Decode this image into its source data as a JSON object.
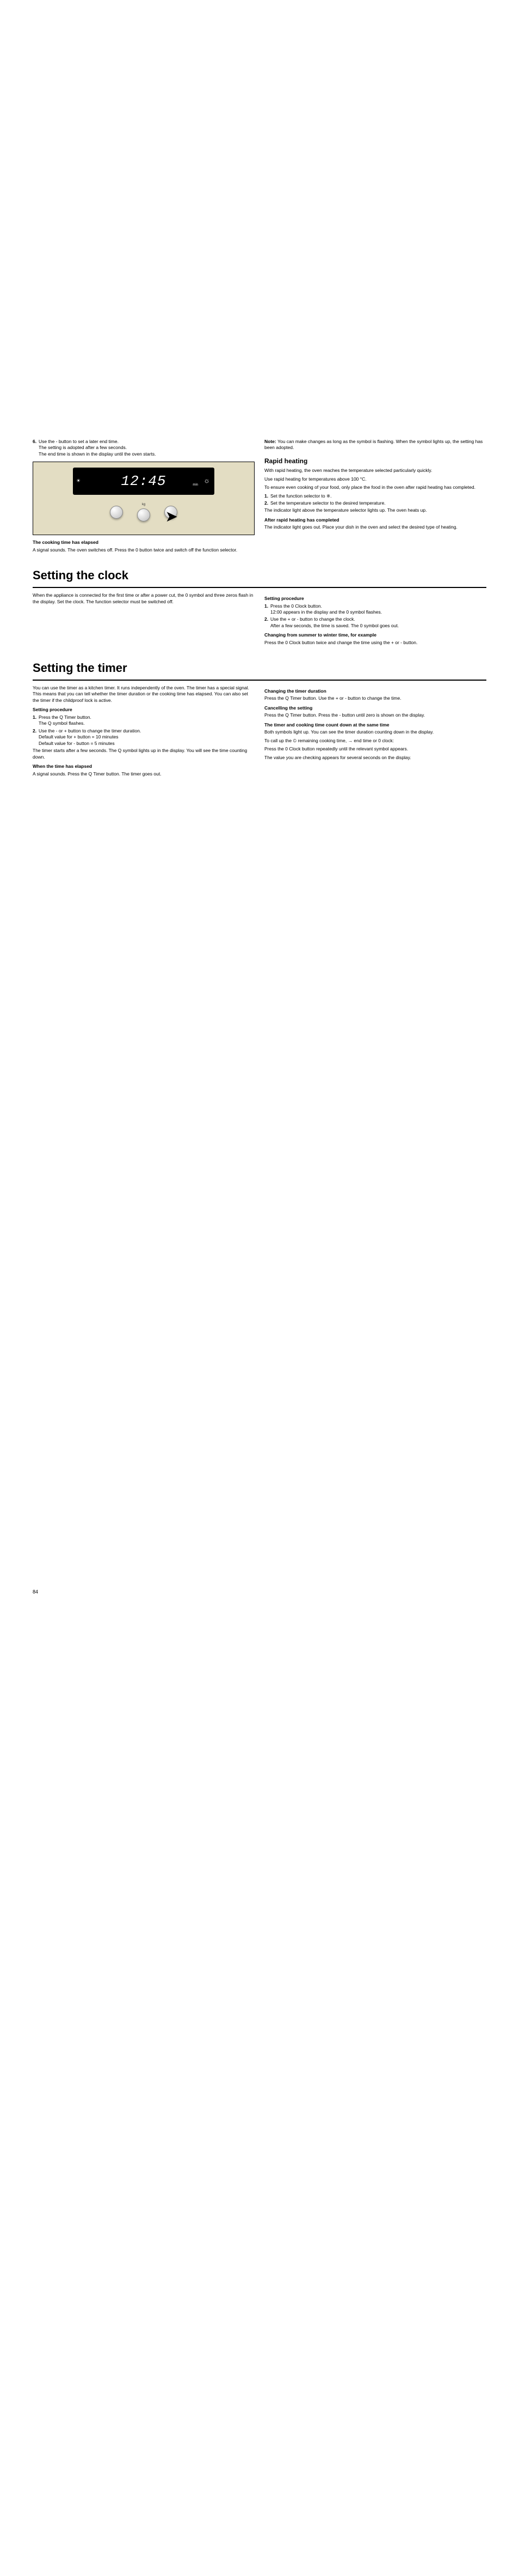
{
  "step6": {
    "n": "6.",
    "t": "Use the - button to set a later end time.",
    "l2": "The setting is adopted after a few seconds.",
    "l3": "The end time is shown in the display until the oven starts."
  },
  "display": {
    "time": "12:45",
    "min": "min"
  },
  "elapsed": {
    "h": "The cooking time has elapsed",
    "p1": "A signal sounds. The oven switches off. Press the 0 button twice and switch off the function selector."
  },
  "note": {
    "b": "Note: ",
    "t": "You can make changes as long as the symbol is flashing. When the symbol lights up, the setting has been adopted."
  },
  "rapid": {
    "h": "Rapid heating",
    "p1": "With rapid heating, the oven reaches the temperature selected particularly quickly.",
    "p2": "Use rapid heating for temperatures above 100 °C.",
    "p3": "To ensure even cooking of your food, only place the food in the oven after rapid heating has completed.",
    "s1n": "1.",
    "s1": "Set the function selector to ※.",
    "s2n": "2.",
    "s2": "Set the temperature selector to the desired temperature.",
    "p4": "The indicator light above the temperature selector lights up. The oven heats up.",
    "h2": "After rapid heating has completed",
    "p5": "The indicator light goes out. Place your dish in the oven and select the desired type of heating."
  },
  "clock": {
    "h": "Setting the clock",
    "intro": "When the appliance is connected for the first time or after a power cut, the 0 symbol and three zeros flash in the display. Set the clock. The function selector must be switched off.",
    "proc": "Setting procedure",
    "s1n": "1.",
    "s1a": "Press the 0 Clock button.",
    "s1b": "12:00 appears in the display and the 0  symbol flashes.",
    "s2n": "2.",
    "s2a": "Use the + or - button to change the clock.",
    "s2b": "After a few seconds, the time is saved. The 0 symbol goes out.",
    "chg": "Changing from summer to winter time, for example",
    "chgp": "Press the 0 Clock button twice and change the time using the + or - button."
  },
  "timer": {
    "h": "Setting the timer",
    "intro": "You can use the timer as a kitchen timer. It runs independently of the oven. The timer has a special signal. This means that you can tell whether the timer duration or the cooking time has elapsed. You can also set the timer if the childproof lock is active.",
    "proc": "Setting procedure",
    "s1n": "1.",
    "s1a": "Press the Q Timer button.",
    "s1b": "The Q symbol flashes.",
    "s2n": "2.",
    "s2a": "Use the - or + button to change the timer duration.",
    "s2b": "Default value for + button = 10 minutes",
    "s2c": "Default value for - button = 5 minutes",
    "p3": "The timer starts after a few seconds. The Q symbol lights up in the display. You will see the time counting down.",
    "whe": "When the time has elapsed",
    "whep": "A signal sounds. Press the Q Timer button. The timer goes out.",
    "chd": "Changing the timer duration",
    "chdp": "Press the Q Timer button. Use the + or - button to change the time.",
    "can": "Cancelling the setting",
    "canp": "Press the Q Timer button. Press the - button until zero is shown on the display.",
    "both": "The timer and cooking time count down at the same time",
    "bothp1": "Both symbols light up. You can see the timer duration counting down in the display.",
    "bothp2": "To call up the ⏲ remaining cooking time, → end time or 0 clock:",
    "bothp3": "Press the 0 Clock button repeatedly until the relevant symbol appears.",
    "bothp4": "The value you are checking appears for several seconds on the display."
  },
  "knobs": {
    "k1": "",
    "k2": "kg",
    "k3": ""
  },
  "page": "84"
}
